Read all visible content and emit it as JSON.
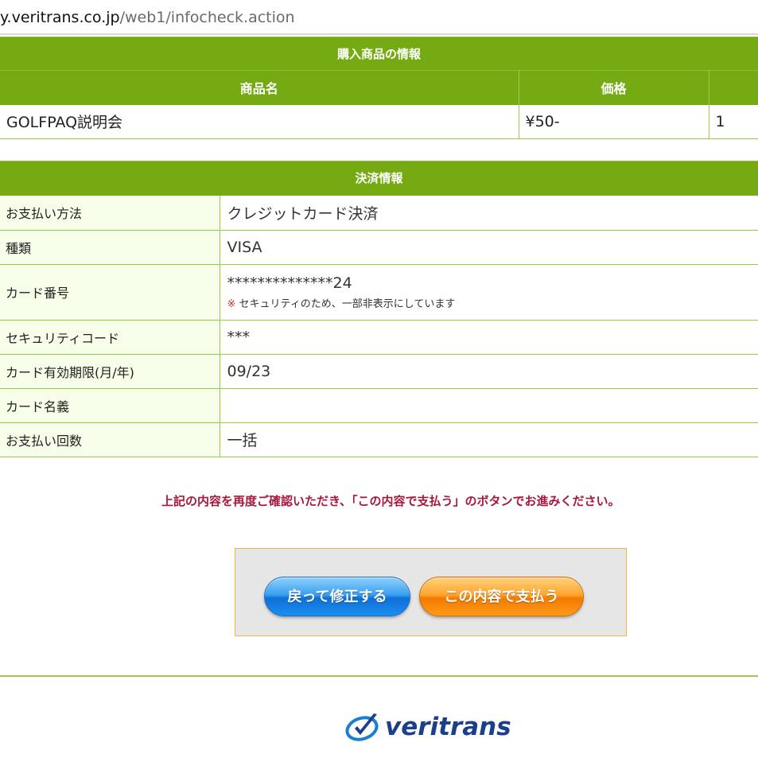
{
  "browser": {
    "url_host": "y.veritrans.co.jp",
    "url_path": "/web1/infocheck.action"
  },
  "purchase": {
    "title": "購入商品の情報",
    "columns": [
      "商品名",
      "価格",
      ""
    ],
    "rows": [
      [
        "GOLFPAQ説明会",
        "¥50-",
        "1"
      ]
    ]
  },
  "payment": {
    "title": "決済情報",
    "method_label": "お支払い方法",
    "method_value": "クレジットカード決済",
    "type_label": "種類",
    "type_value": "VISA",
    "card_number_label": "カード番号",
    "card_number_value": "**************24",
    "card_number_note_mark": "※",
    "card_number_note": " セキュリティのため、一部非表示にしています",
    "security_code_label": "セキュリティコード",
    "security_code_value": "***",
    "expiry_label": "カード有効期限(月/年)",
    "expiry_value": "09/23",
    "card_name_label": "カード名義",
    "card_name_value": "",
    "installments_label": "お支払い回数",
    "installments_value": "一括"
  },
  "confirm_message": "上記の内容を再度ご確認いただき、「この内容で支払う」のボタンでお進みください。",
  "buttons": {
    "back_label": "戻って修正する",
    "pay_label": "この内容で支払う"
  },
  "footer": {
    "logo_text": "veritrans"
  },
  "colors": {
    "header_green": "#76aa12",
    "label_bg": "#f6fde8",
    "message_red": "#a8173c",
    "back_button_blue": "#1a8ef0",
    "pay_button_orange": "#ff9a1a",
    "logo_navy": "#1b3f8a"
  }
}
